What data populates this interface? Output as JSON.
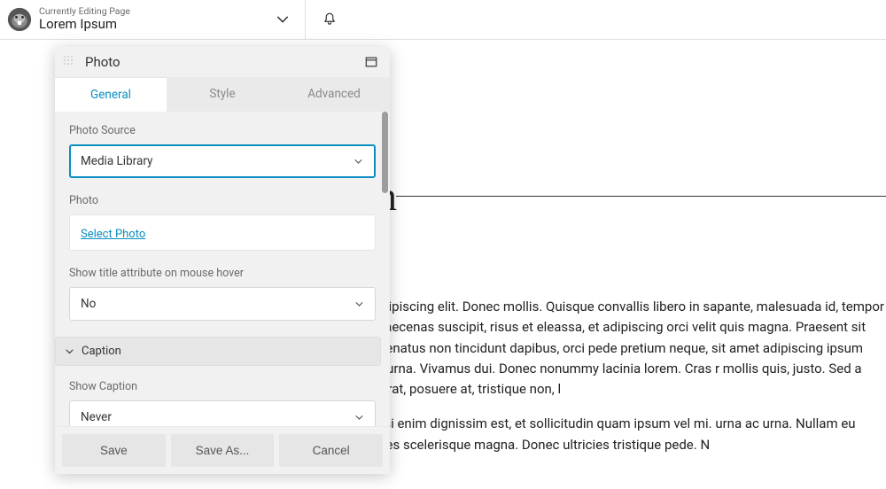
{
  "header": {
    "subtitle": "Currently Editing Page",
    "title": "Lorem Ipsum"
  },
  "canvas": {
    "title_fragment": "n",
    "paragraph1": "amet, consectetuer adipiscing elit. Donec mollis. Quisque convallis libero in sapante, malesuada id, tempor eu, gravida id, odio. Maecenas suscipit, risus et eleassa, et adipiscing orci velit quis magna. Praesent sit amet ligula id orci venenatus non tincidunt dapibus, orci pede pretium neque, sit amet adipiscing ipsum abitur mattis quam id urna. Vivamus dui. Donec nonummy lacinia lorem. Cras r mollis quis, justo. Sed a libero. Quisque risus erat, posuere at, tristique non, l",
    "paragraph2": "is semper pharetra, nisi enim dignissim est, et sollicitudin quam ipsum vel mi. urna ac urna. Nullam eu tortor. Curabitur sodales scelerisque magna. Donec ultricies tristique pede. N"
  },
  "panel": {
    "title": "Photo",
    "tabs": {
      "general": "General",
      "style": "Style",
      "advanced": "Advanced"
    },
    "fields": {
      "photo_source_label": "Photo Source",
      "photo_source_value": "Media Library",
      "photo_label": "Photo",
      "select_photo": "Select Photo",
      "show_title_label": "Show title attribute on mouse hover",
      "show_title_value": "No",
      "caption_section": "Caption",
      "show_caption_label": "Show Caption",
      "show_caption_value": "Never"
    },
    "footer": {
      "save": "Save",
      "save_as": "Save As...",
      "cancel": "Cancel"
    }
  }
}
